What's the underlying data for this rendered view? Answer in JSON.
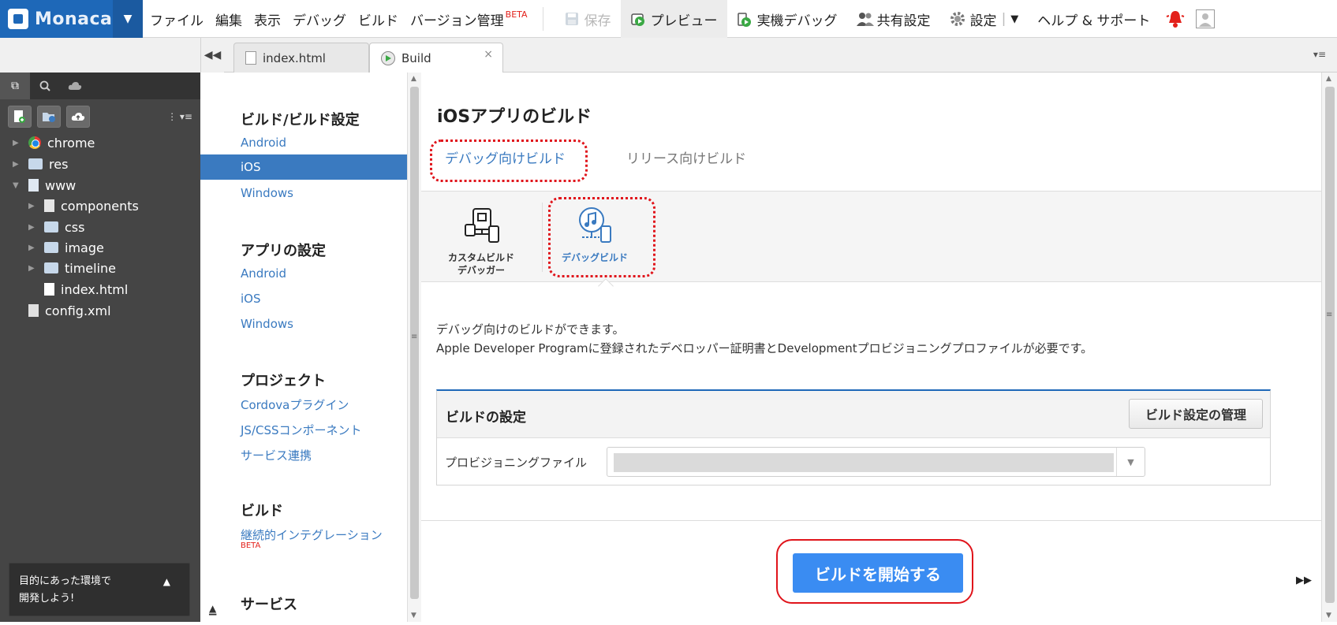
{
  "app": {
    "logo_text": "Monaca",
    "logo_caret": "▼"
  },
  "menu": {
    "items": [
      "ファイル",
      "編集",
      "表示",
      "デバッグ",
      "ビルド"
    ],
    "version_control": "バージョン管理",
    "beta": "BETA"
  },
  "toolbar": {
    "save": "保存",
    "preview": "プレビュー",
    "device_debug": "実機デバッグ",
    "share": "共有設定",
    "settings": "設定",
    "settings_caret": "▼",
    "help": "ヘルプ & サポート"
  },
  "tabs": [
    {
      "label": "index.html"
    },
    {
      "label": "Build",
      "close": "×"
    }
  ],
  "sidebar": {
    "tree": [
      {
        "label": "chrome",
        "arrow": "▶"
      },
      {
        "label": "res",
        "arrow": "▶"
      },
      {
        "label": "www",
        "arrow": "▼"
      },
      {
        "label": "components",
        "arrow": "▶"
      },
      {
        "label": "css",
        "arrow": "▶"
      },
      {
        "label": "image",
        "arrow": "▶"
      },
      {
        "label": "timeline",
        "arrow": "▶"
      },
      {
        "label": "index.html",
        "arrow": ""
      },
      {
        "label": "config.xml",
        "arrow": ""
      }
    ],
    "promo_line1": "目的にあった環境で",
    "promo_line2": "開発しよう!"
  },
  "settings_nav": {
    "build_heading": "ビルド/ビルド設定",
    "build_android": "Android",
    "build_ios": "iOS",
    "build_windows": "Windows",
    "app_heading": "アプリの設定",
    "app_android": "Android",
    "app_ios": "iOS",
    "app_windows": "Windows",
    "project_heading": "プロジェクト",
    "project_cordova": "Cordovaプラグイン",
    "project_jscss": "JS/CSSコンポーネント",
    "project_services": "サービス連携",
    "build2_heading": "ビルド",
    "ci": "継続的インテグレーション",
    "ci_beta": "BETA",
    "service_heading": "サービス"
  },
  "main": {
    "title": "iOSアプリのビルド",
    "tab_debug": "デバッグ向けビルド",
    "tab_release": "リリース向けビルド",
    "opt_custom_line1": "カスタムビルド",
    "opt_custom_line2": "デバッガー",
    "opt_debug": "デバッグビルド",
    "desc_line1": "デバッグ向けのビルドができます。",
    "desc_line2": "Apple Developer Programに登録されたデベロッパー証明書とDevelopmentプロビジョニングプロファイルが必要です。",
    "panel_title": "ビルドの設定",
    "manage_button": "ビルド設定の管理",
    "provisioning_label": "プロビジョニングファイル",
    "start_button": "ビルドを開始する"
  },
  "colors": {
    "brand": "#1e68b8",
    "link": "#3a7ac0",
    "accent_button": "#3a8cf2",
    "highlight": "#e0141b"
  }
}
